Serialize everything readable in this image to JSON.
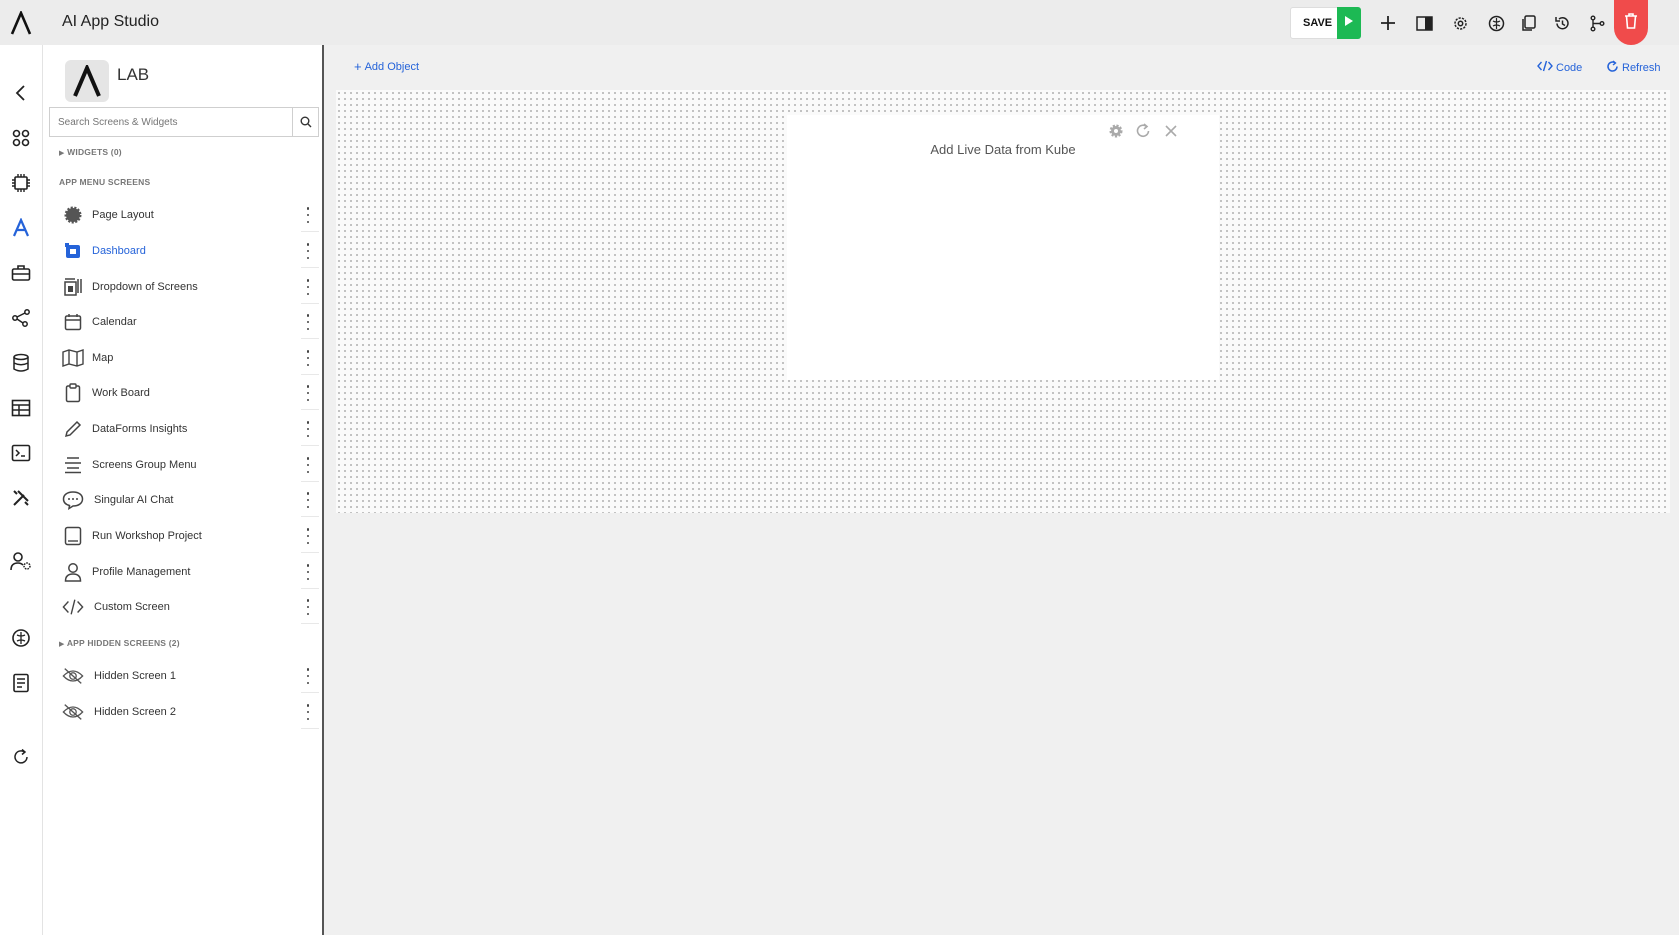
{
  "app": {
    "title": "AI App Studio"
  },
  "toolbar": {
    "save_label": "SAVE",
    "icons": [
      "play-icon",
      "plus-icon",
      "panel-icon",
      "settings-icon",
      "brain-icon",
      "copy-icon",
      "history-icon",
      "branch-icon",
      "trash-icon"
    ],
    "delete_color": "#f04b4b",
    "run_color": "#1db954"
  },
  "leftnav": {
    "icons": [
      "back-icon",
      "apps-icon",
      "chip-icon",
      "studio-icon",
      "toolbox-icon",
      "graph-icon",
      "database-icon",
      "table-icon",
      "terminal-icon",
      "tools-icon",
      "user-settings-icon",
      "brain-icon",
      "book-icon",
      "refresh-icon"
    ]
  },
  "sidebar": {
    "title": "LAB",
    "search_placeholder": "Search Screens & Widgets",
    "widgets_header": "WIDGETS (0)",
    "menu_header": "APP MENU SCREENS",
    "hidden_header": "APP HIDDEN SCREENS (2)",
    "screens": [
      {
        "label": "Page Layout",
        "icon": "gear-badge-icon"
      },
      {
        "label": "Dashboard",
        "icon": "dashboard-icon",
        "active": true
      },
      {
        "label": "Dropdown of Screens",
        "icon": "dropdown-icon"
      },
      {
        "label": "Calendar",
        "icon": "calendar-icon"
      },
      {
        "label": "Map",
        "icon": "map-icon"
      },
      {
        "label": "Work Board",
        "icon": "clipboard-icon"
      },
      {
        "label": "DataForms Insights",
        "icon": "pencil-icon"
      },
      {
        "label": "Screens Group Menu",
        "icon": "menu-icon"
      },
      {
        "label": "Singular AI Chat",
        "icon": "chat-icon"
      },
      {
        "label": "Run Workshop Project",
        "icon": "tablet-icon"
      },
      {
        "label": "Profile Management",
        "icon": "user-icon"
      },
      {
        "label": "Custom Screen",
        "icon": "code-icon"
      }
    ],
    "hidden_screens": [
      {
        "label": "Hidden Screen 1",
        "icon": "eye-off-icon"
      },
      {
        "label": "Hidden Screen 2",
        "icon": "eye-off-icon"
      }
    ]
  },
  "main": {
    "add_object_label": "Add Object",
    "code_label": "Code",
    "refresh_label": "Refresh",
    "widget_text": "Add Live Data from Kube"
  },
  "colors": {
    "accent": "#2563d9"
  }
}
